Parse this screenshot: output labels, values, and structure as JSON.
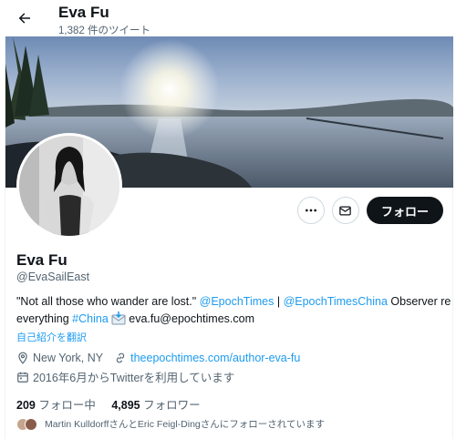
{
  "header": {
    "name": "Eva Fu",
    "tweet_count": "1,382 件のツイート"
  },
  "profile": {
    "name": "Eva Fu",
    "handle": "@EvaSailEast",
    "bio": {
      "quote": "\"Not all those who wander are lost.\" ",
      "mention1": "@EpochTimes",
      "sep": " | ",
      "mention2": "@EpochTimesChina",
      "text1": " Observer re",
      "text2": "everything ",
      "hashtag": "#China",
      "email": " eva.fu@epochtimes.com"
    },
    "translate": "自己紹介を翻訳",
    "location": "New York, NY",
    "website": "theepochtimes.com/author-eva-fu",
    "joined": "2016年6月からTwitterを利用しています",
    "following_count": "209",
    "following_label": "フォロー中",
    "followers_count": "4,895",
    "followers_label": "フォロワー",
    "followed_by": "Martin KulldorffさんとEric Feigl-Dingさんにフォローされています"
  },
  "actions": {
    "follow": "フォロー"
  },
  "icons": {
    "back": "back-arrow-icon",
    "more": "more-icon",
    "message": "message-icon",
    "location": "location-pin-icon",
    "link": "link-icon",
    "calendar": "calendar-icon",
    "mail": "incoming-envelope-icon"
  },
  "colors": {
    "accent": "#1d9bf0",
    "text": "#0f1419",
    "secondary": "#536471",
    "follow_bg": "#0f1419"
  }
}
